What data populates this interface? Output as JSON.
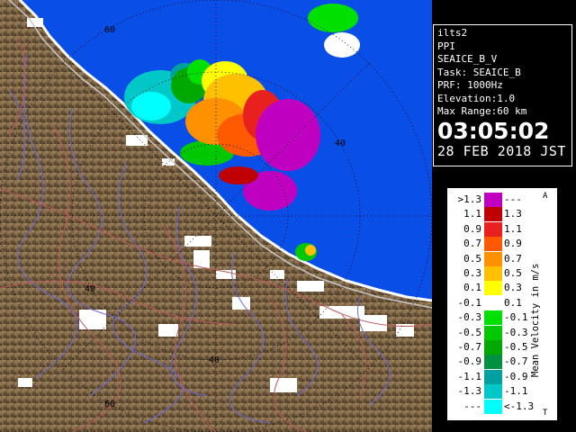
{
  "info": {
    "station": "ilts2",
    "scan_type": "PPI",
    "product": "SEAICE_B_V",
    "task": "Task: SEAICE_B",
    "prf": "PRF: 1000Hz",
    "elevation": "Elevation:1.0",
    "max_range": "Max Range:60 km",
    "time": "03:05:02",
    "date": "28 FEB 2018 JST"
  },
  "map": {
    "range_rings_km": [
      20,
      40,
      60
    ],
    "ring_labels": [
      "60",
      "40",
      "40",
      "40",
      "60"
    ],
    "colors": {
      "sea": "#0a4ee8",
      "land": "#7a6244",
      "coast": "#ffffff",
      "river": "#6a6ad8",
      "road": "#b85a5a",
      "grid": "#000000"
    }
  },
  "legend": {
    "title": "Mean Velocity in m/s",
    "corner_top": "A",
    "corner_bottom": "T",
    "rows": [
      {
        "left": ">1.3",
        "right": "---",
        "color": "#c000c0"
      },
      {
        "left": "1.1",
        "right": "1.3",
        "color": "#c00000"
      },
      {
        "left": "0.9",
        "right": "1.1",
        "color": "#e82020"
      },
      {
        "left": "0.7",
        "right": "0.9",
        "color": "#ff5a00"
      },
      {
        "left": "0.5",
        "right": "0.7",
        "color": "#ff9000"
      },
      {
        "left": "0.3",
        "right": "0.5",
        "color": "#ffc000"
      },
      {
        "left": "0.1",
        "right": "0.3",
        "color": "#ffff00"
      },
      {
        "left": "-0.1",
        "right": "0.1",
        "color": "#ffffff"
      },
      {
        "left": "-0.3",
        "right": "-0.1",
        "color": "#00e000"
      },
      {
        "left": "-0.5",
        "right": "-0.3",
        "color": "#00c800"
      },
      {
        "left": "-0.7",
        "right": "-0.5",
        "color": "#00a800"
      },
      {
        "left": "-0.9",
        "right": "-0.7",
        "color": "#009040"
      },
      {
        "left": "-1.1",
        "right": "-0.9",
        "color": "#00a0a0"
      },
      {
        "left": "-1.3",
        "right": "-1.1",
        "color": "#00c8c8"
      },
      {
        "left": "---",
        "right": "<-1.3",
        "color": "#00ffff"
      }
    ]
  }
}
